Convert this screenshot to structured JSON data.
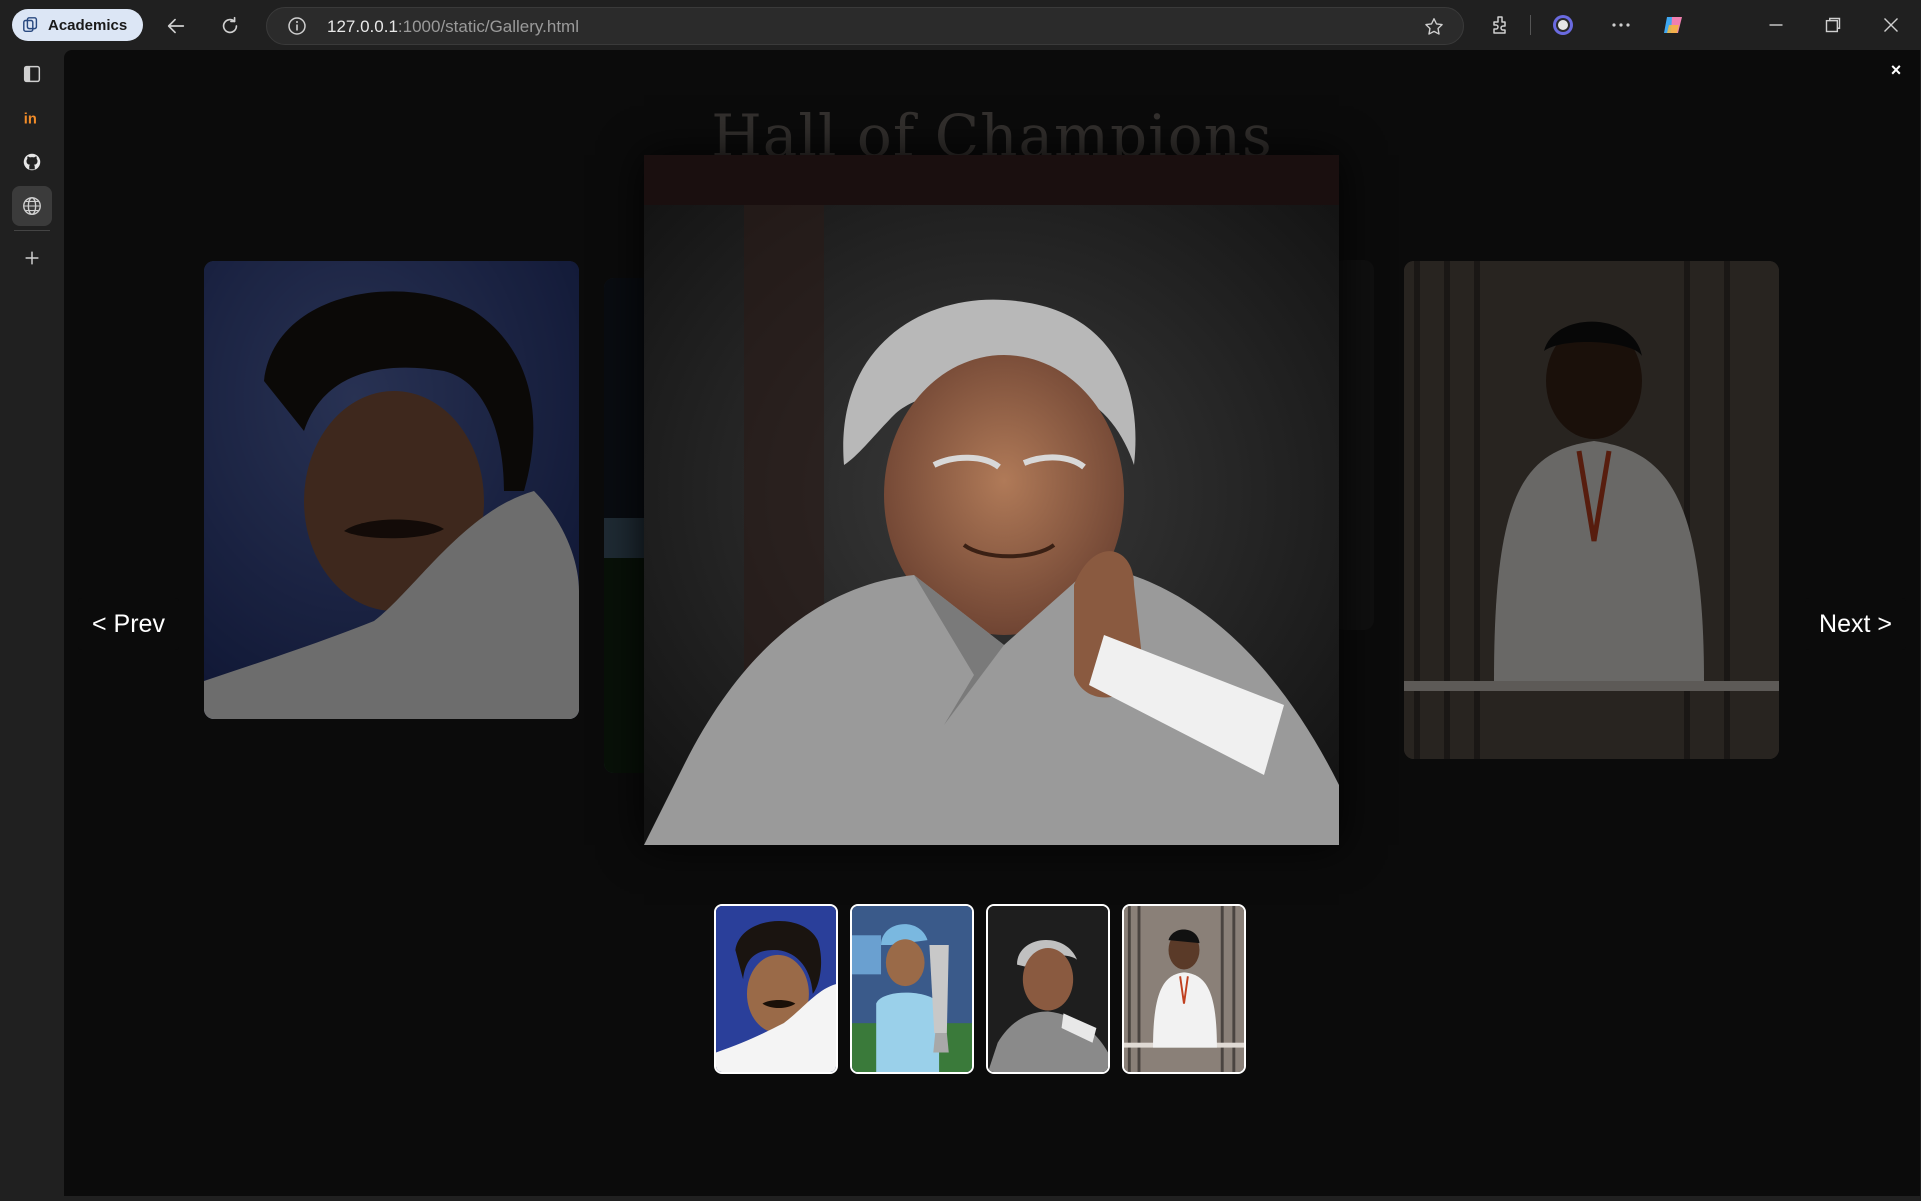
{
  "browser": {
    "profile_label": "Academics",
    "address_host": "127.0.0.1",
    "address_path": ":1000/static/Gallery.html",
    "icons": [
      "back-arrow-icon",
      "refresh-icon",
      "info-icon",
      "star-icon",
      "extensions-icon",
      "copilot-ring-icon",
      "more-icon",
      "copilot-icon",
      "minimize-icon",
      "restore-icon",
      "close-icon"
    ]
  },
  "sidebar": {
    "items": [
      "sidebar-toggle-icon",
      "invision-icon",
      "github-icon",
      "globe-icon",
      "add-icon"
    ]
  },
  "gallery": {
    "title": "Hall of Champions",
    "prev_label": "< Prev",
    "next_label": "Next >",
    "close_label": "×",
    "thumbnails": [
      "portrait-1",
      "portrait-2",
      "portrait-3",
      "portrait-4"
    ],
    "active_index": 3
  },
  "colors": {
    "background": "#0b0b0b",
    "title": "#33302e",
    "chrome": "#202020"
  }
}
